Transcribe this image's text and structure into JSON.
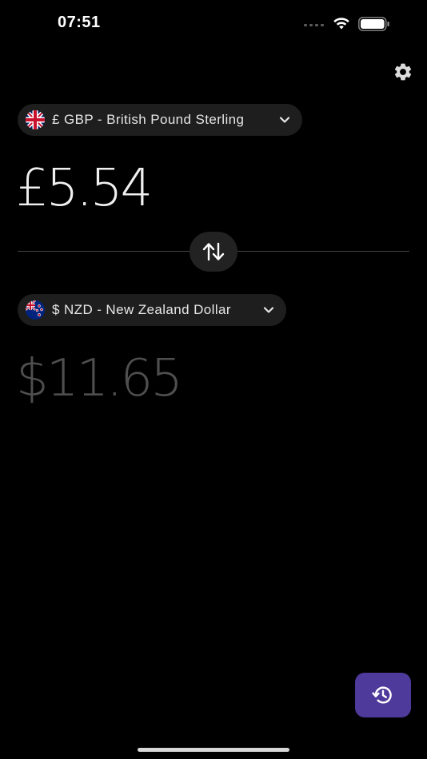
{
  "status_bar": {
    "time": "07:51"
  },
  "icons": {
    "settings": "gear-icon",
    "swap": "swap-arrows-icon",
    "history": "history-icon",
    "chevron": "chevron-down-icon"
  },
  "from_currency": {
    "label": "£ GBP - British Pound Sterling",
    "flag": "uk-flag-icon",
    "amount": "£5.54"
  },
  "to_currency": {
    "label": "$ NZD - New Zealand Dollar",
    "flag": "nz-flag-icon",
    "amount": "$11.65"
  },
  "colors": {
    "background": "#000000",
    "pill": "#1e1e1e",
    "accent": "#4e3a9a",
    "amount_primary": "#f0f0f0",
    "amount_secondary": "#4f4f4f"
  }
}
